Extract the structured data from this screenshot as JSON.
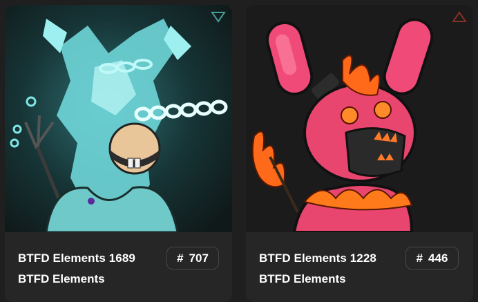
{
  "cards": [
    {
      "title": "BTFD Elements 1689",
      "collection": "BTFD Elements",
      "badge_prefix": "#",
      "rank": "707",
      "image_alt": "Ice element bunny artwork",
      "accent": "#7fe6e6",
      "corner_icon": "triangle-down-icon"
    },
    {
      "title": "BTFD Elements 1228",
      "collection": "BTFD Elements",
      "badge_prefix": "#",
      "rank": "446",
      "image_alt": "Fire element bunny artwork",
      "accent": "#ff6a4a",
      "corner_icon": "triangle-up-icon"
    }
  ],
  "colors": {
    "page_bg": "#1f1f1f",
    "card_bg": "#262626",
    "badge_border": "#474747",
    "text": "#ffffff"
  }
}
